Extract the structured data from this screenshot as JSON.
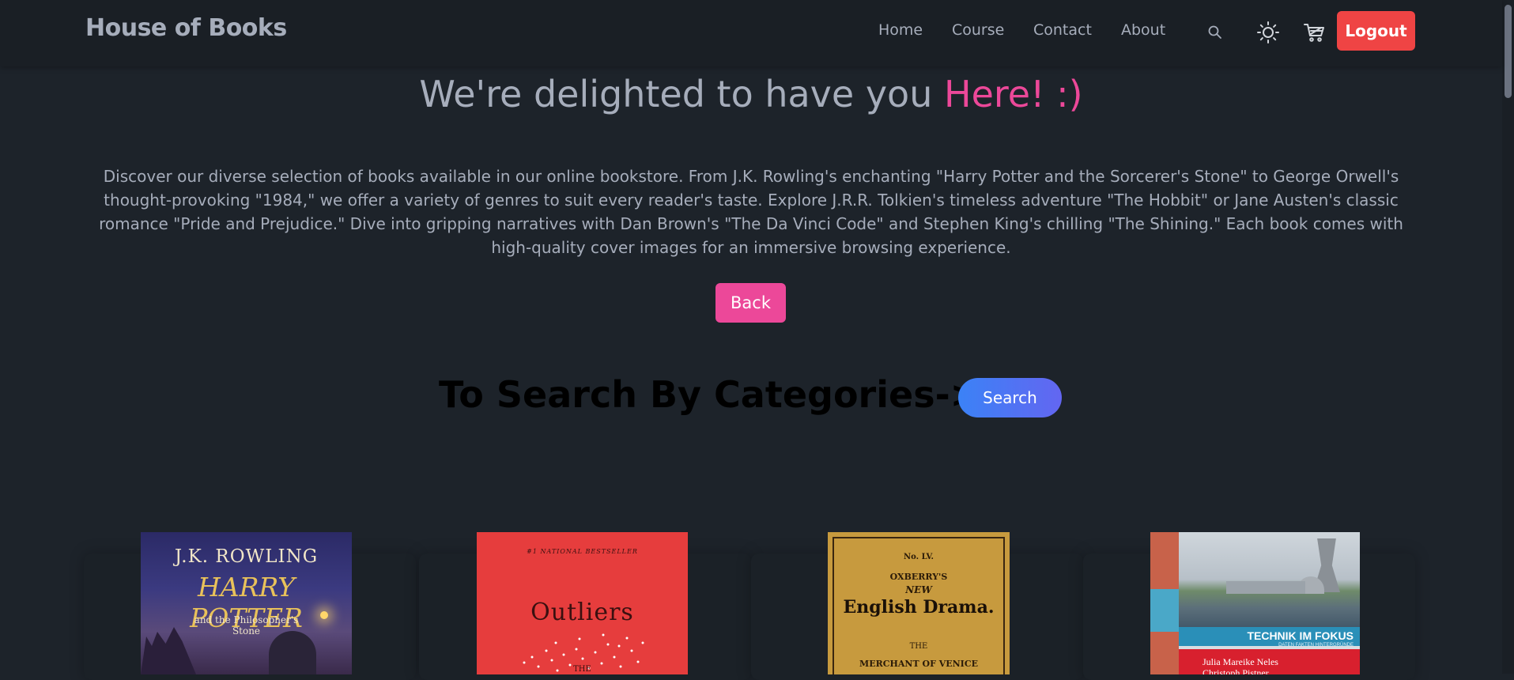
{
  "navbar": {
    "brand": "House of Books",
    "links": [
      "Home",
      "Course",
      "Contact",
      "About"
    ],
    "logout_label": "Logout",
    "icons": [
      "search-icon",
      "sun-icon",
      "cart-icon"
    ]
  },
  "hero": {
    "headline_main": "We're delighted to have you ",
    "headline_accent": "Here! :)",
    "intro_text": "Discover our diverse selection of books available in our online bookstore. From J.K. Rowling's enchanting \"Harry Potter and the Sorcerer's Stone\" to George Orwell's thought-provoking \"1984,\" we offer a variety of genres to suit every reader's taste. Explore J.R.R. Tolkien's timeless adventure \"The Hobbit\" or Jane Austen's classic romance \"Pride and Prejudice.\" Dive into gripping narratives with Dan Brown's \"The Da Vinci Code\" and Stephen King's chilling \"The Shining.\" Each book comes with high-quality cover images for an immersive browsing experience.",
    "back_label": "Back"
  },
  "categories": {
    "heading": "To Search By Categories->",
    "search_label": "Search"
  },
  "books": [
    {
      "cover_author": "J.K. ROWLING",
      "cover_title": "HARRY POTTER",
      "cover_subtitle": "and the Philosopher's Stone"
    },
    {
      "cover_top": "#1 NATIONAL BESTSELLER",
      "cover_title": "Outliers",
      "cover_bottom": "THE"
    },
    {
      "cover_no": "No. LV.",
      "cover_publisher": "OXBERRY'S",
      "cover_new": "NEW",
      "cover_title": "English Drama.",
      "cover_the": "THE",
      "cover_bottom": "MERCHANT OF VENICE"
    },
    {
      "cover_title": "TECHNIK IM FOKUS",
      "cover_tagline": "DATEN  FAKTEN  HINTERGRÜNDE",
      "cover_author1": "Julia Mareike Neles",
      "cover_author2": "Christoph Pistner"
    }
  ]
}
